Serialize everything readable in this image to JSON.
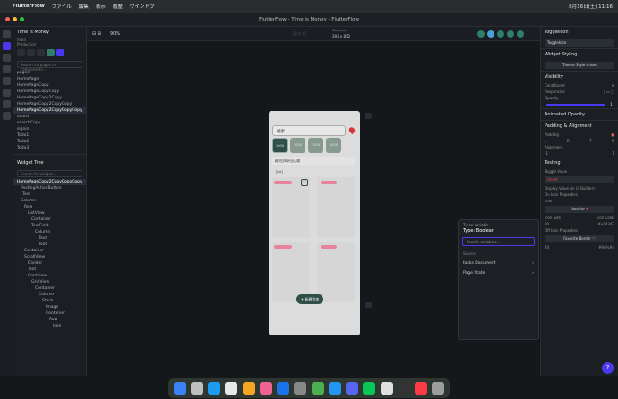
{
  "menubar": {
    "app": "FlutterFlow",
    "items": [
      "ファイル",
      "編集",
      "表示",
      "履歴",
      "ウインドウ"
    ],
    "clock": "8月16日(土) 11:16"
  },
  "window": {
    "title": "FlutterFlow - Time is Money - FlutterFlow"
  },
  "project": {
    "name": "Time is Money",
    "branch": "main",
    "mode": "Production"
  },
  "toolbar": {
    "zoom": "90%",
    "device": "Size (px)",
    "device_size": "393 x 852"
  },
  "pages": {
    "label": "pages",
    "items": [
      "HomePage",
      "HomePageCopy",
      "HomePageCopyCopy",
      "HomePageCopy2Copy",
      "HomePageCopy2CopyCopy",
      "HomePageCopy2CopyCopyCopy",
      "search",
      "searchCopy",
      "signin",
      "Todo1",
      "Todo2",
      "Todo3"
    ]
  },
  "widget_tree": {
    "label": "Widget Tree",
    "search_placeholder": "Search for widget...",
    "items": [
      "HomePageCopy2CopyCopyCopy",
      "PostingActionButton",
      "Text",
      "Column",
      "Row",
      "ListView",
      "Container",
      "TextField",
      "Column",
      "Text",
      "Text",
      "Container",
      "ScrollView",
      "Divider",
      "Text",
      "Container",
      "GridView",
      "Container",
      "Column",
      "Stack",
      "Image",
      "Container",
      "Row",
      "Icon"
    ]
  },
  "phone": {
    "search_text": "検索",
    "chips": [
      "1000",
      "1000",
      "1000",
      "1000"
    ],
    "dropdown": "締切日時が近い順",
    "section_label": "[list]",
    "fab_label": "+ 新規追加"
  },
  "variable_panel": {
    "title": "Tie to Variable",
    "type": "Type: Boolean",
    "search_placeholder": "Search variables...",
    "source_label": "Source",
    "rows": [
      "tasks Document",
      "Page State"
    ]
  },
  "rightpanel": {
    "widget_name": "ToggleIcon",
    "widget_field": "ToggleIcon",
    "styling": "Widget Styling",
    "theme_button": "Theme Style Unset",
    "visibility": "Visibility",
    "conditional": "Conditional",
    "responsive": "Responsive",
    "opacity": "Opacity",
    "opacity_value": "1",
    "animated_opacity": "Animated Opacity",
    "padding": "Padding & Alignment",
    "padding_label": "Padding",
    "alignment": "Alignment",
    "align_vals": [
      "-1",
      "1"
    ],
    "padding_vals": [
      "L",
      "R",
      "T",
      "B"
    ],
    "testing": "Testing",
    "toggle_value": "Toggle Value",
    "unset": "Unset",
    "display_value": "Display Value (in UI Builder)",
    "on_icon": "On Icon Properties",
    "icon": "Icon",
    "on_icon_name": "Favorite",
    "icon_size": "Icon Size",
    "icon_color": "Icon Color",
    "on_size": "20",
    "on_color": "#e74343",
    "off_icon": "Off Icon Properties",
    "off_icon_name": "Favorite Border",
    "off_size": "20",
    "off_color": "#9c9c9d"
  },
  "colors": {
    "accent": "#4b39ef",
    "dark_green": "#2f4f48",
    "toggle_red": "#e74343"
  }
}
